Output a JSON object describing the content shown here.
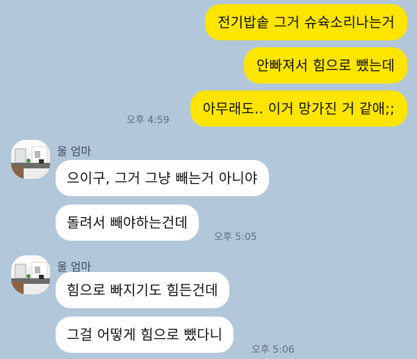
{
  "sent_messages": [
    {
      "text": "전기밥솥 그거 슈슉소리나는거"
    },
    {
      "text": "안빠져서 힘으로 뺐는데"
    },
    {
      "text": "아무래도.. 이거 망가진 거 같애;;",
      "time": "오후 4:59"
    }
  ],
  "groups": [
    {
      "sender": "울 엄마",
      "messages": [
        {
          "text": "으이구, 그거 그냥 빼는거 아니야"
        },
        {
          "text": "돌려서 빼야하는건데",
          "time": "오후 5:05"
        }
      ]
    },
    {
      "sender": "울 엄마",
      "messages": [
        {
          "text": "힘으로 빠지기도 힘든건데"
        },
        {
          "text": "그걸 어떻게 힘으로 뺐다니",
          "time": "오후 5:06"
        }
      ]
    }
  ],
  "colors": {
    "background": "#b2c7d9",
    "sent_bubble": "#fee500",
    "received_bubble": "#ffffff",
    "timestamp": "#5d6f80"
  },
  "icons": {
    "avatar": "kitchen-photo-avatar"
  }
}
